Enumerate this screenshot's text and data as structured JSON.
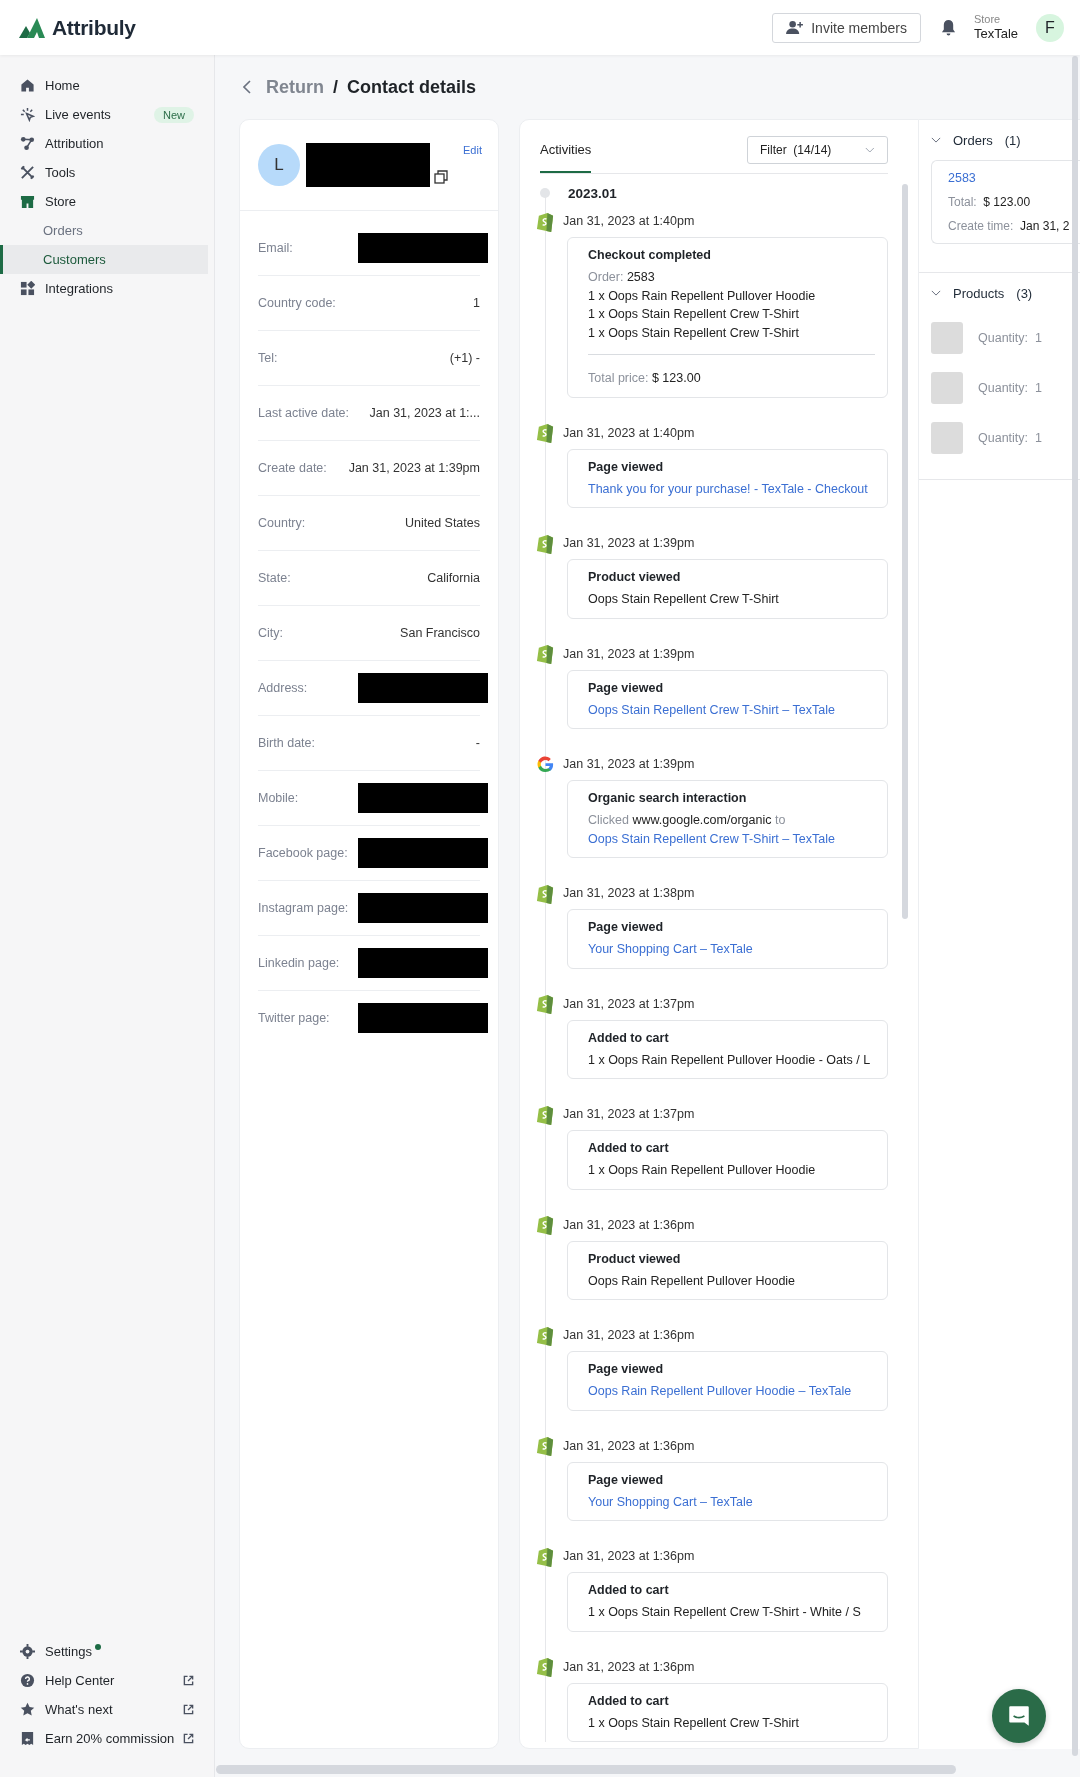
{
  "app": {
    "name": "Attribuly"
  },
  "header": {
    "invite_button": "Invite members",
    "store_label": "Store",
    "store_name": "TexTale",
    "avatar": "F"
  },
  "sidebar": {
    "items": [
      {
        "label": "Home",
        "kind": "home",
        "selected": false
      },
      {
        "label": "Live events",
        "kind": "live",
        "badge": "New",
        "selected": false
      },
      {
        "label": "Attribution",
        "kind": "attribution",
        "selected": false
      },
      {
        "label": "Tools",
        "kind": "tools",
        "selected": false
      },
      {
        "label": "Store",
        "kind": "store",
        "selected": false,
        "children": [
          {
            "label": "Orders",
            "selected": false
          },
          {
            "label": "Customers",
            "selected": true
          }
        ]
      },
      {
        "label": "Integrations",
        "kind": "integrations",
        "selected": false
      }
    ],
    "footer_items": [
      {
        "label": "Settings",
        "kind": "settings",
        "dot": true,
        "external": false
      },
      {
        "label": "Help Center",
        "kind": "help",
        "dot": false,
        "external": true
      },
      {
        "label": "What's next",
        "kind": "star",
        "dot": false,
        "external": true
      },
      {
        "label": "Earn 20% commission",
        "kind": "commission",
        "dot": false,
        "external": true
      }
    ]
  },
  "breadcrumb": {
    "back": "Return",
    "separator": "/",
    "current": "Contact details"
  },
  "contact": {
    "avatar": "L",
    "edit": "Edit",
    "fields": [
      {
        "label": "Email:",
        "kind": "redacted"
      },
      {
        "label": "Country code:",
        "kind": "text",
        "value": "1"
      },
      {
        "label": "Tel:",
        "kind": "text",
        "value": "(+1) -"
      },
      {
        "label": "Last active date:",
        "kind": "text",
        "value": "Jan 31, 2023 at 1:..."
      },
      {
        "label": "Create date:",
        "kind": "text",
        "value": "Jan 31, 2023 at 1:39pm"
      },
      {
        "label": "Country:",
        "kind": "text",
        "value": "United States"
      },
      {
        "label": "State:",
        "kind": "text",
        "value": "California"
      },
      {
        "label": "City:",
        "kind": "text",
        "value": "San Francisco"
      },
      {
        "label": "Address:",
        "kind": "redacted"
      },
      {
        "label": "Birth date:",
        "kind": "text",
        "value": "-"
      },
      {
        "label": "Mobile:",
        "kind": "redacted"
      },
      {
        "label": "Facebook page:",
        "kind": "redacted"
      },
      {
        "label": "Instagram page:",
        "kind": "redacted"
      },
      {
        "label": "Linkedin page:",
        "kind": "redacted"
      },
      {
        "label": "Twitter page:",
        "kind": "redacted"
      }
    ]
  },
  "activities": {
    "tab": "Activities",
    "filter": "Filter  (14/14)",
    "month": "2023.01",
    "items": [
      {
        "source": {
          "kind": "shopify"
        },
        "time": "Jan 31, 2023 at 1:40pm",
        "kind": "checkout",
        "title": "Checkout completed",
        "order_label": "Order:",
        "order": "2583",
        "lines": [
          "1 x Oops Rain Repellent Pullover Hoodie",
          "1 x Oops Stain Repellent Crew T-Shirt",
          "1 x Oops Stain Repellent Crew T-Shirt"
        ],
        "total_label": "Total price:",
        "total": "$ 123.00"
      },
      {
        "source": {
          "kind": "shopify"
        },
        "time": "Jan 31, 2023 at 1:40pm",
        "kind": "link",
        "title": "Page viewed",
        "text": "Thank you for your purchase! - TexTale - Checkout"
      },
      {
        "source": {
          "kind": "shopify"
        },
        "time": "Jan 31, 2023 at 1:39pm",
        "kind": "plain",
        "title": "Product viewed",
        "text": "Oops Stain Repellent Crew T-Shirt"
      },
      {
        "source": {
          "kind": "shopify"
        },
        "time": "Jan 31, 2023 at 1:39pm",
        "kind": "link",
        "title": "Page viewed",
        "text": "Oops Stain Repellent Crew T-Shirt – TexTale"
      },
      {
        "source": {
          "kind": "google"
        },
        "time": "Jan 31, 2023 at 1:39pm",
        "kind": "search",
        "title": "Organic search interaction",
        "clicked": "Clicked",
        "url": "www.google.com/organic",
        "to": "to",
        "text": "Oops Stain Repellent Crew T-Shirt – TexTale"
      },
      {
        "source": {
          "kind": "shopify"
        },
        "time": "Jan 31, 2023 at 1:38pm",
        "kind": "link",
        "title": "Page viewed",
        "text": "Your Shopping Cart – TexTale"
      },
      {
        "source": {
          "kind": "shopify"
        },
        "time": "Jan 31, 2023 at 1:37pm",
        "kind": "plain",
        "title": "Added to cart",
        "text": "1 x Oops Rain Repellent Pullover Hoodie - Oats / L"
      },
      {
        "source": {
          "kind": "shopify"
        },
        "time": "Jan 31, 2023 at 1:37pm",
        "kind": "plain",
        "title": "Added to cart",
        "text": "1 x Oops Rain Repellent Pullover Hoodie"
      },
      {
        "source": {
          "kind": "shopify"
        },
        "time": "Jan 31, 2023 at 1:36pm",
        "kind": "plain",
        "title": "Product viewed",
        "text": "Oops Rain Repellent Pullover Hoodie"
      },
      {
        "source": {
          "kind": "shopify"
        },
        "time": "Jan 31, 2023 at 1:36pm",
        "kind": "link",
        "title": "Page viewed",
        "text": "Oops Rain Repellent Pullover Hoodie – TexTale"
      },
      {
        "source": {
          "kind": "shopify"
        },
        "time": "Jan 31, 2023 at 1:36pm",
        "kind": "link",
        "title": "Page viewed",
        "text": "Your Shopping Cart – TexTale"
      },
      {
        "source": {
          "kind": "shopify"
        },
        "time": "Jan 31, 2023 at 1:36pm",
        "kind": "plain",
        "title": "Added to cart",
        "text": "1 x Oops Stain Repellent Crew T-Shirt - White / S"
      },
      {
        "source": {
          "kind": "shopify"
        },
        "time": "Jan 31, 2023 at 1:36pm",
        "kind": "plain",
        "title": "Added to cart",
        "text": "1 x Oops Stain Repellent Crew T-Shirt"
      }
    ]
  },
  "orders": {
    "title": "Orders",
    "count": "(1)",
    "expanded": true,
    "items": [
      {
        "number": "2583",
        "total_label": "Total:",
        "total": "$ 123.00",
        "time_label": "Create time:",
        "time": "Jan 31, 2"
      }
    ]
  },
  "products": {
    "title": "Products",
    "count": "(3)",
    "expanded": true,
    "items": [
      {
        "quantity_label": "Quantity:",
        "quantity": "1"
      },
      {
        "quantity_label": "Quantity:",
        "quantity": "1"
      },
      {
        "quantity_label": "Quantity:",
        "quantity": "1"
      }
    ]
  }
}
